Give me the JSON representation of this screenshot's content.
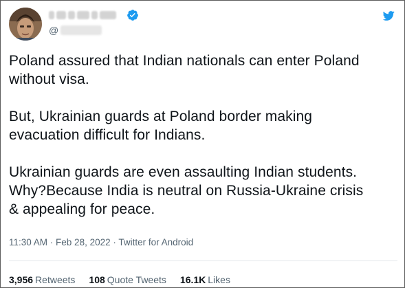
{
  "tweet": {
    "handle_prefix": "@",
    "icons": {
      "verified": "verified-badge-icon",
      "brand": "twitter-bird-icon"
    },
    "colors": {
      "brand_blue": "#1d9bf0",
      "text": "#0f1419",
      "secondary": "#536471"
    },
    "text": "Poland assured that Indian nationals can enter Poland\nwithout visa.\n\nBut, Ukrainian guards at Poland border making\nevacuation difficult for Indians.\n\nUkrainian guards are even assaulting Indian students.\nWhy?Because India is neutral on Russia-Ukraine crisis\n& appealing for peace.",
    "meta": {
      "time": "11:30 AM",
      "separator1": " · ",
      "date": "Feb 28, 2022",
      "separator2": " · ",
      "source": "Twitter for Android"
    },
    "stats": {
      "retweets_count": "3,956",
      "retweets_label": "Retweets",
      "quotes_count": "108",
      "quotes_label": "Quote Tweets",
      "likes_count": "16.1K",
      "likes_label": "Likes"
    }
  }
}
